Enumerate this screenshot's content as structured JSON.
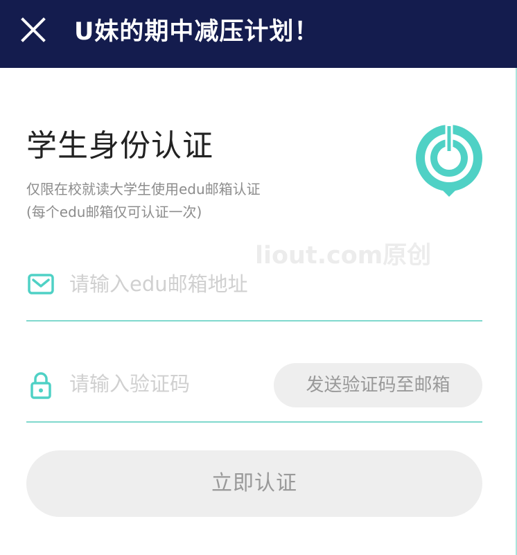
{
  "header": {
    "title": "U妹的期中减压计划！",
    "close_icon": "close-icon"
  },
  "intro": {
    "title": "学生身份认证",
    "subtitle_line1": "仅限在校就读大学生使用edu邮箱认证",
    "subtitle_line2": "(每个edu邮箱仅可认证一次)",
    "logo_icon": "location-power-logo-icon"
  },
  "watermark": "liout.com原创",
  "email_field": {
    "icon": "mail-icon",
    "value": "",
    "placeholder": "请输入edu邮箱地址"
  },
  "code_field": {
    "icon": "lock-icon",
    "value": "",
    "placeholder": "请输入验证码",
    "send_button_label": "发送验证码至邮箱"
  },
  "submit_label": "立即认证",
  "colors": {
    "header_bg": "#141c4e",
    "accent": "#4fd1c5",
    "button_bg": "#eeeeee",
    "button_text": "#999999"
  }
}
